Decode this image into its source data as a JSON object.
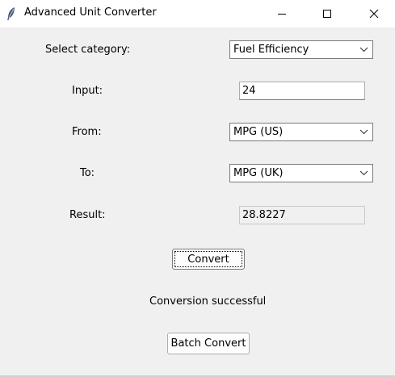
{
  "window": {
    "title": "Advanced Unit Converter",
    "icons": {
      "app": "feather-icon",
      "minimize": "minimize-icon",
      "maximize": "maximize-icon",
      "close": "close-icon"
    }
  },
  "form": {
    "category_label": "Select category:",
    "category_value": "Fuel Efficiency",
    "input_label": "Input:",
    "input_value": "24",
    "from_label": "From:",
    "from_value": "MPG (US)",
    "to_label": "To:",
    "to_value": "MPG (UK)",
    "result_label": "Result:",
    "result_value": "28.8227"
  },
  "actions": {
    "convert_label": "Convert",
    "status_text": "Conversion successful",
    "batch_label": "Batch Convert"
  }
}
